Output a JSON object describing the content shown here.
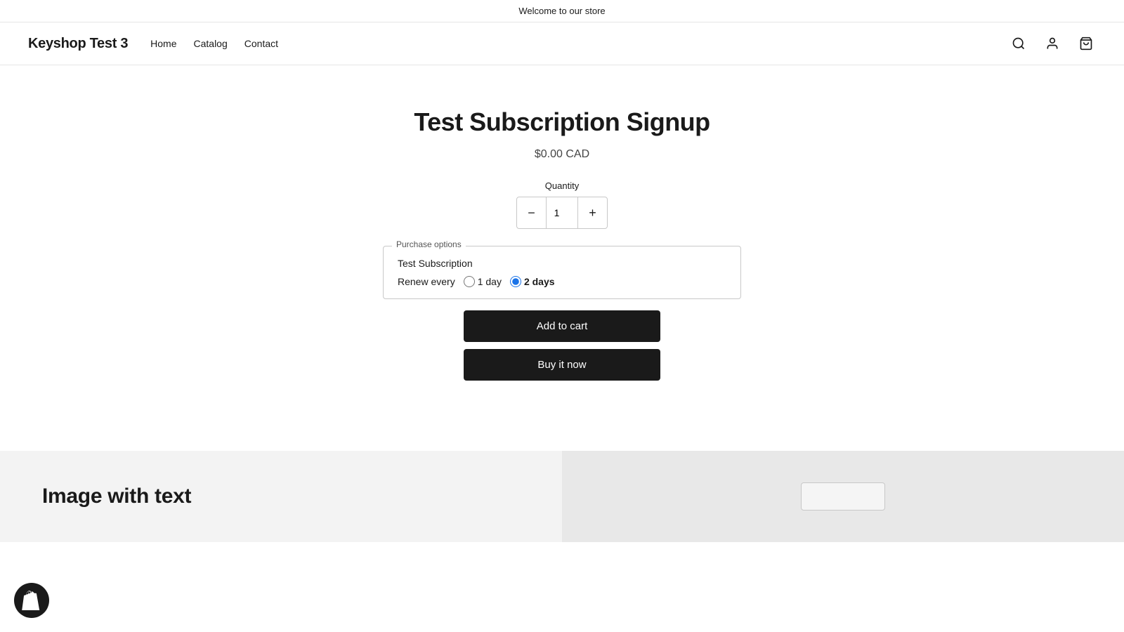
{
  "announcement": {
    "text": "Welcome to our store"
  },
  "header": {
    "store_name": "Keyshop Test 3",
    "nav": [
      {
        "label": "Home",
        "href": "#"
      },
      {
        "label": "Catalog",
        "href": "#"
      },
      {
        "label": "Contact",
        "href": "#"
      }
    ]
  },
  "product": {
    "title": "Test Subscription Signup",
    "price": "$0.00 CAD",
    "quantity_label": "Quantity",
    "quantity_value": "1",
    "purchase_options_legend": "Purchase options",
    "subscription_name": "Test Subscription",
    "renew_label": "Renew every",
    "options": [
      {
        "label": "1 day",
        "value": "1day",
        "selected": false
      },
      {
        "label": "2 days",
        "value": "2days",
        "selected": true
      }
    ],
    "add_to_cart_label": "Add to cart",
    "buy_it_now_label": "Buy it now"
  },
  "bottom": {
    "image_with_text_title": "Image with text"
  }
}
